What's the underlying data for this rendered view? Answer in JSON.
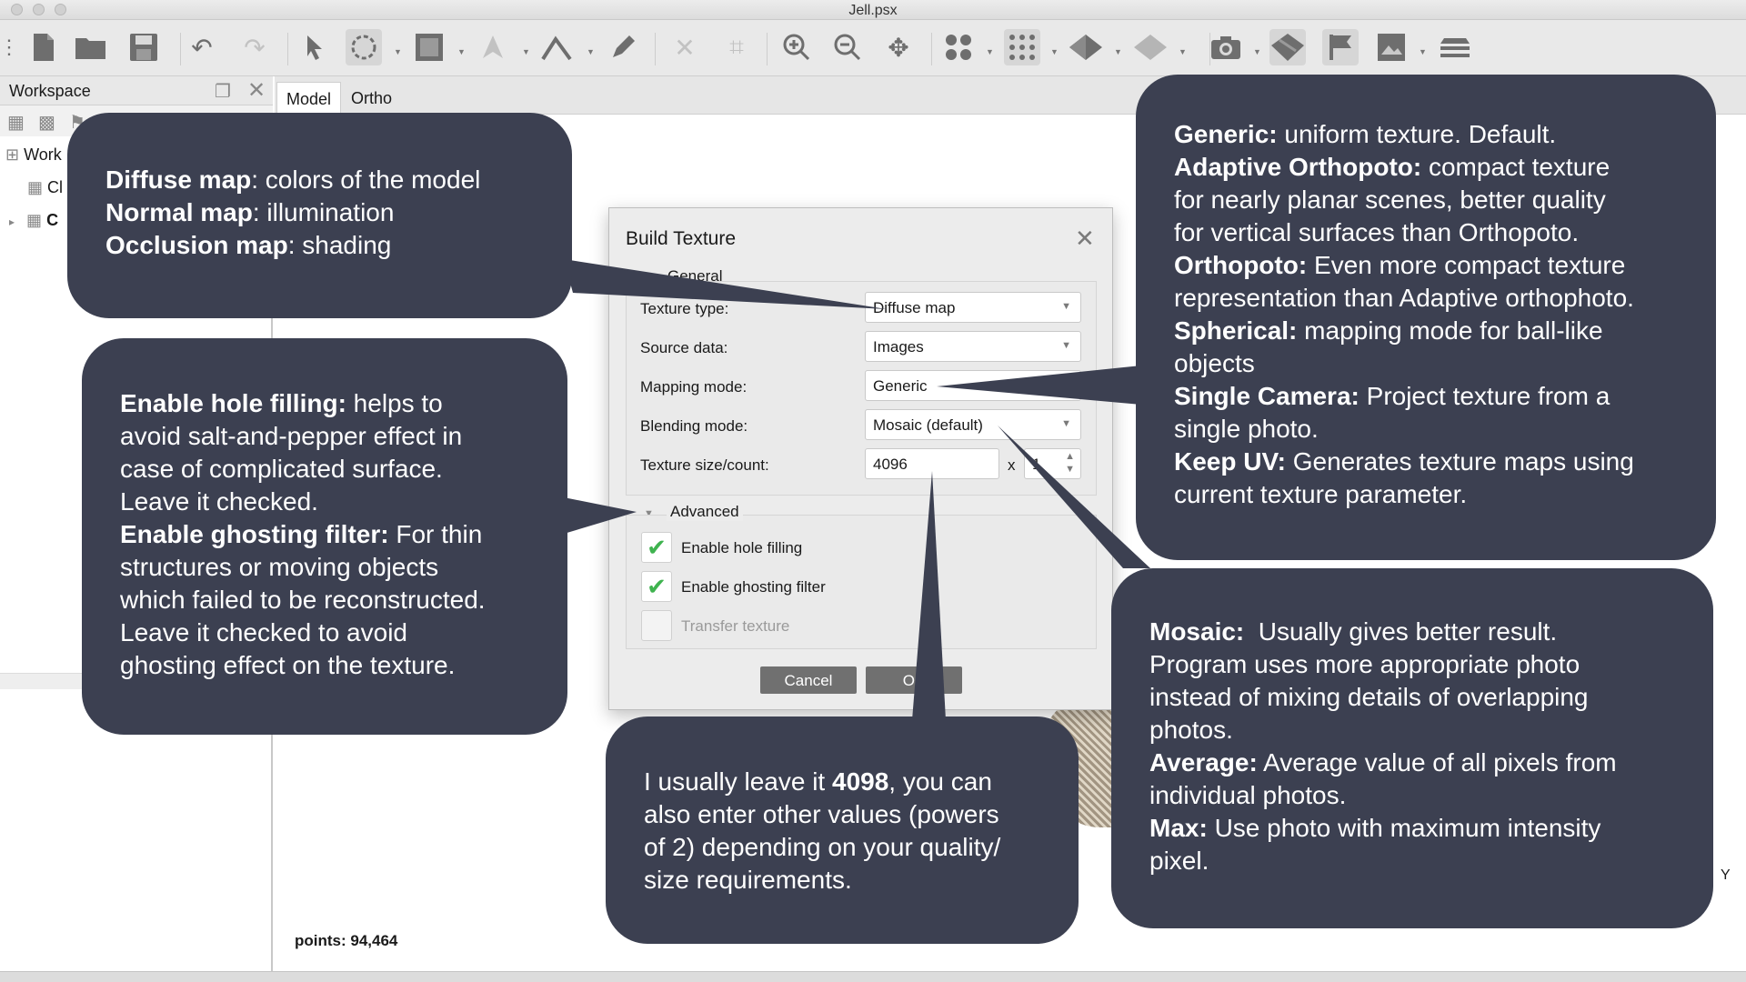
{
  "window": {
    "title": "Jell.psx"
  },
  "toolbar": {
    "icons": [
      "new-document",
      "open-folder",
      "save",
      "undo",
      "redo",
      "select-arrow",
      "rotate-select",
      "rectangle-select",
      "navigation",
      "ruler-measure",
      "draw-tool",
      "delete",
      "crop",
      "zoom-in",
      "zoom-out",
      "move-region",
      "point-cloud",
      "dense-cloud",
      "shaded-model",
      "solid-model",
      "camera",
      "textured-model",
      "flag",
      "ortho-view",
      "layers"
    ]
  },
  "workspace": {
    "title": "Workspace",
    "tree": {
      "root": "Work",
      "child1": "Cl",
      "child2": "C"
    }
  },
  "tabs": [
    "Model",
    "Ortho"
  ],
  "status": {
    "points": "points: 94,464",
    "axis_label": "Y"
  },
  "dialog": {
    "title": "Build Texture",
    "group_general": "General",
    "fields": {
      "texture_type_label": "Texture type:",
      "texture_type_value": "Diffuse map",
      "source_data_label": "Source data:",
      "source_data_value": "Images",
      "mapping_mode_label": "Mapping mode:",
      "mapping_mode_value": "Generic",
      "blending_mode_label": "Blending mode:",
      "blending_mode_value": "Mosaic (default)",
      "texture_size_label": "Texture size/count:",
      "texture_size_value": "4096",
      "times": "x",
      "texture_count_value": "1"
    },
    "group_advanced": "Advanced",
    "checkboxes": [
      {
        "label": "Enable hole filling",
        "checked": true,
        "enabled": true
      },
      {
        "label": "Enable ghosting filter",
        "checked": true,
        "enabled": true
      },
      {
        "label": "Transfer texture",
        "checked": false,
        "enabled": false
      }
    ],
    "buttons": {
      "cancel": "Cancel",
      "ok": "OK"
    }
  },
  "callouts": {
    "texture_type": [
      [
        "Diffuse map",
        ": colors of the model"
      ],
      [
        "Normal map",
        ": illumination"
      ],
      [
        "Occlusion map",
        ": shading"
      ]
    ],
    "advanced": [
      [
        "Enable hole filling:",
        " helps to"
      ],
      [
        "",
        "avoid salt-and-pepper effect in"
      ],
      [
        "",
        "case of complicated surface."
      ],
      [
        "",
        "Leave it checked."
      ],
      [
        "Enable ghosting filter:",
        " For thin"
      ],
      [
        "",
        "structures or moving objects"
      ],
      [
        "",
        "which failed to be reconstructed."
      ],
      [
        "",
        "Leave it checked to avoid"
      ],
      [
        "",
        "ghosting effect on the texture."
      ]
    ],
    "mapping": [
      [
        "Generic:",
        " uniform texture. Default."
      ],
      [
        "Adaptive Orthopoto:",
        " compact texture"
      ],
      [
        "",
        "for nearly planar scenes, better quality"
      ],
      [
        "",
        "for vertical surfaces than Orthopoto."
      ],
      [
        "Orthopoto:",
        " Even more compact texture"
      ],
      [
        "",
        "representation than Adaptive orthophoto."
      ],
      [
        "Spherical:",
        " mapping mode for ball-like"
      ],
      [
        "",
        "objects"
      ],
      [
        "Single Camera:",
        " Project texture from a"
      ],
      [
        "",
        "single photo."
      ],
      [
        "Keep UV:",
        " Generates texture maps using"
      ],
      [
        "",
        "current texture parameter."
      ]
    ],
    "blending": [
      [
        "Mosaic:",
        "  Usually gives better result."
      ],
      [
        "",
        "Program uses more appropriate photo"
      ],
      [
        "",
        "instead of mixing details of overlapping"
      ],
      [
        "",
        "photos."
      ],
      [
        "Average:",
        " Average value of all pixels from"
      ],
      [
        "",
        "individual photos."
      ],
      [
        "Max:",
        " Use photo with maximum intensity"
      ],
      [
        "",
        "pixel."
      ]
    ],
    "size": [
      [
        "",
        "I usually leave it ",
        "4098",
        ", you can"
      ],
      [
        "",
        "also enter other values (powers"
      ],
      [
        "",
        "of 2) depending on your quality/"
      ],
      [
        "",
        "size requirements."
      ]
    ]
  },
  "colors": {
    "callout_bg": "#3c4051",
    "check_green": "#3fb34f",
    "button_gray": "#707070"
  }
}
